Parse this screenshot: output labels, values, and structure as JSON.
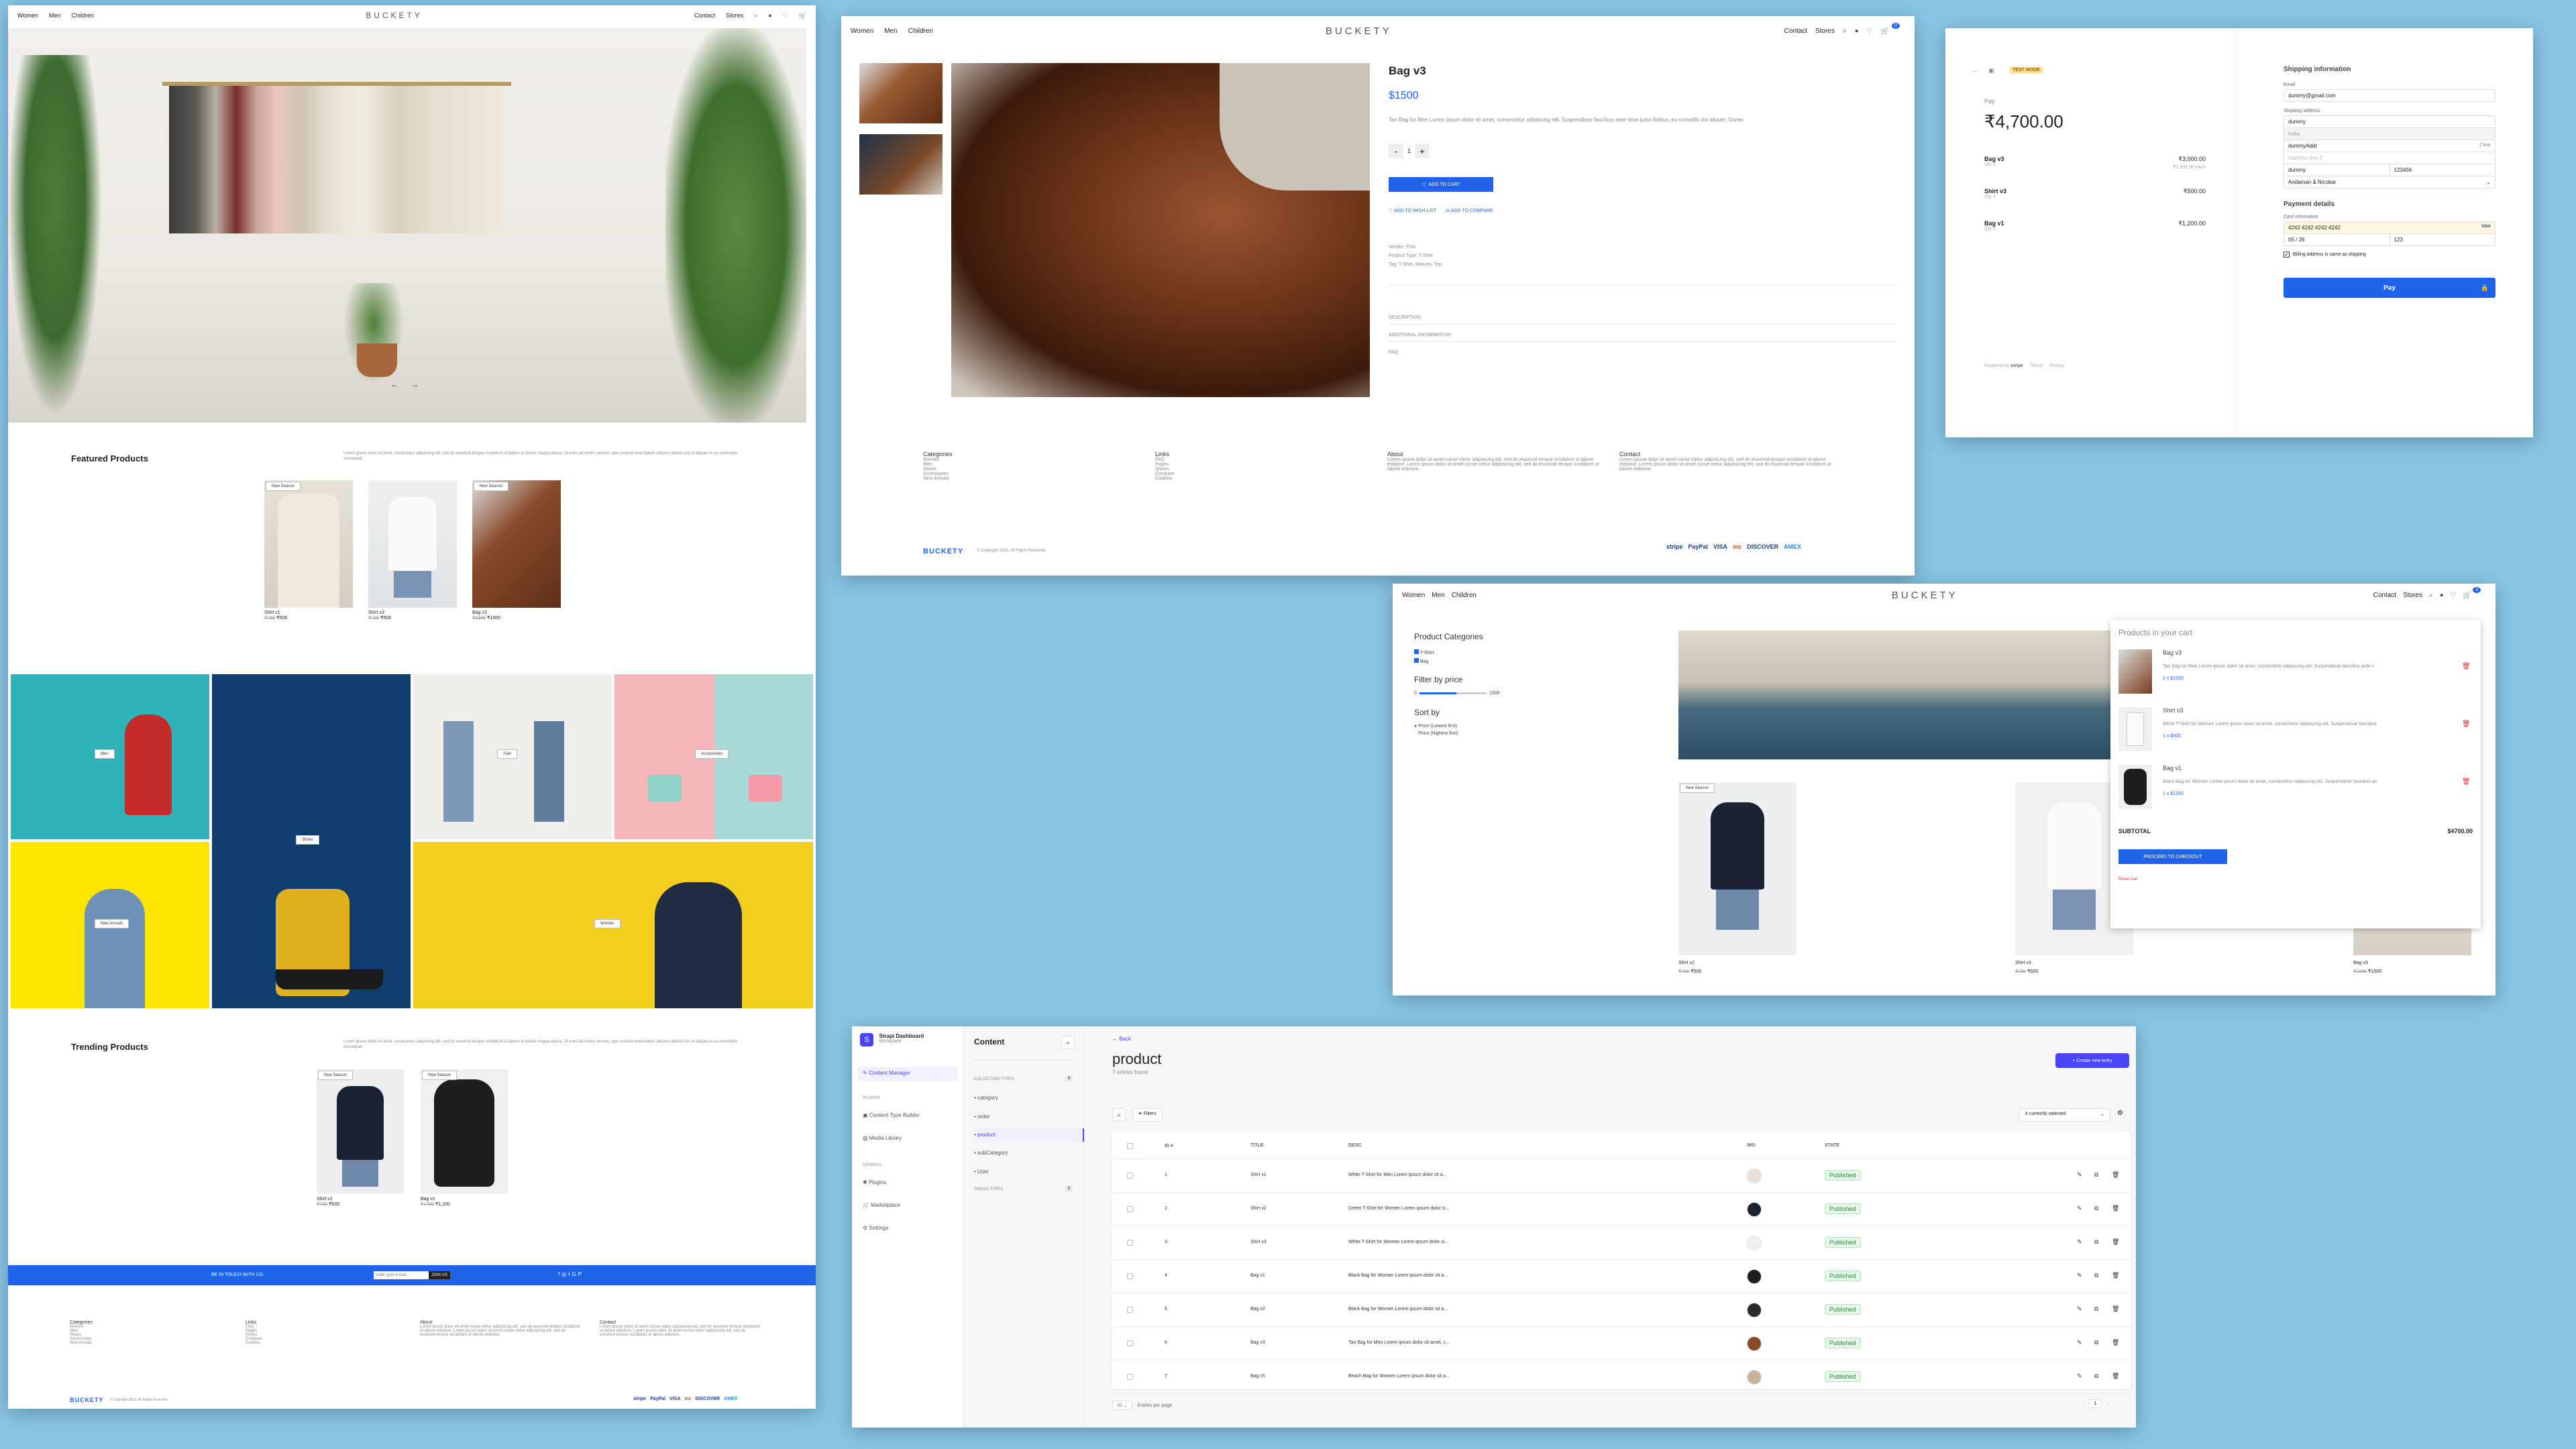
{
  "brand": "BUCKETY",
  "nav": {
    "women": "Women",
    "men": "Men",
    "children": "Children",
    "contact": "Contact",
    "stores": "Stores",
    "cart_count": "0",
    "cart_count_b": "3"
  },
  "home": {
    "featured_title": "Featured Products",
    "featured_desc": "Lorem ipsum dolor sit amet, consectetur adipiscing elit, sed do eiusmod tempor incididunt ut labore et dolore magna aliqua. Ut enim ad minim veniam, quis nostrud exercitation ullamco laboris nisi ut aliquip ex ea commodo consequat.",
    "featured": [
      {
        "badge": "New Season",
        "name": "Shirt v1",
        "old": "₹799",
        "price": "₹500"
      },
      {
        "badge": "",
        "name": "Shirt v3",
        "old": "₹799",
        "price": "₹500"
      },
      {
        "badge": "New Season",
        "name": "Bag v3",
        "old": "₹1999",
        "price": "₹1500"
      }
    ],
    "categories": [
      "Men",
      "Shoes",
      "Sale",
      "Women",
      "Accessories",
      "New Arrivals"
    ],
    "trending_title": "Trending Products",
    "trending_desc": "Lorem ipsum dolor sit amet, consectetur adipiscing elit, sed do eiusmod tempor incididunt ut labore et dolore magna aliqua. Ut enim ad minim veniam, quis nostrud exercitation ullamco laboris nisi ut aliquip ex ea commodo consequat.",
    "trending": [
      {
        "badge": "New Season",
        "name": "Shirt v2",
        "old": "₹799",
        "price": "₹500"
      },
      {
        "badge": "New Season",
        "name": "Bag v1",
        "old": "₹1499",
        "price": "₹1,200"
      }
    ],
    "newsletter_text": "BE IN TOUCH WITH US:",
    "newsletter_placeholder": "Enter your e-mail...",
    "newsletter_button": "JOIN US",
    "copyright": "© Copyright 2023. All Rights Reserved"
  },
  "footer": {
    "categories_title": "Categories",
    "categories": [
      "Women",
      "Men",
      "Shoes",
      "Accessories",
      "New Arrivals"
    ],
    "links_title": "Links",
    "links": [
      "FAQ",
      "Pages",
      "Stores",
      "Compare",
      "Cookies"
    ],
    "about_title": "About",
    "about_text": "Lorem ipsum dolor sit amet conse ctetur adipisicing elit, sed do eiusmod tempor incididunt ut labore etdolore. Lorem ipsum dolor sit amet conse ctetur adipisicing elit, sed do eiusmod tempor incididunt ut labore etdolore.",
    "contact_title": "Contact",
    "contact_text": "Lorem ipsum dolor sit amet conse ctetur adipisicing elit, sed do eiusmod tempor incididunt ut labore etdolore. Lorem ipsum dolor sit amet conse ctetur adipisicing elit, sed do eiusmod tempor incididunt ut labore etdolore.",
    "copyright": "© Copyright 2023. All Rights Reserved",
    "payments": [
      "stripe",
      "PayPal",
      "VISA",
      "mc",
      "DISCOVER",
      "AMEX"
    ]
  },
  "product": {
    "title": "Bag v3",
    "price": "$1500",
    "desc": "Tan Bag for Men Lorem ipsum dolor sit amet, consectetur adipiscing elit. Suspendisse faucibus ante vitae justo finibus, eu convallis dui aliquet. Donec",
    "qty": "1",
    "minus": "-",
    "plus": "+",
    "add_to_cart": "ADD TO CART",
    "wishlist": "ADD TO WISH LIST",
    "compare": "ADD TO COMPARE",
    "meta": [
      "Vendor: Polo",
      "Product Type: T-Shirt",
      "Tag: T-Shirt, Women, Top"
    ],
    "tabs": [
      "DESCRIPTION",
      "ADDITIONAL INFORMATION",
      "FAQ"
    ]
  },
  "checkout": {
    "test_mode": "TEST MODE",
    "pay_label": "Pay",
    "total": "₹4,700.00",
    "items": [
      {
        "name": "Bag v3",
        "qty": "Qty 1",
        "price": "₹3,000.00",
        "each": "₹1,500.00 each"
      },
      {
        "name": "Shirt v3",
        "qty": "Qty 1",
        "price": "₹500.00",
        "each": ""
      },
      {
        "name": "Bag v1",
        "qty": "Qty 1",
        "price": "₹1,200.00",
        "each": ""
      }
    ],
    "powered": "Powered by",
    "stripe": "stripe",
    "terms": "Terms",
    "privacy": "Privacy",
    "shipping_title": "Shipping information",
    "email_label": "Email",
    "email": "dummy@gmail.com",
    "address_label": "Shipping address",
    "name": "dummy",
    "country": "India",
    "address1": "dummyAddr",
    "clear": "Clear",
    "address2_placeholder": "Address line 2",
    "city": "dummy",
    "pin": "123456",
    "state": "Andaman & Nicobar",
    "payment_title": "Payment details",
    "card_label": "Card information",
    "card": "4242 4242 4242 4242",
    "card_brand": "VISA",
    "expiry": "05 / 26",
    "cvc": "123",
    "billing_same": "Billing address is same as shipping",
    "pay_button": "Pay"
  },
  "shop": {
    "categories_title": "Product Categories",
    "cats": [
      "T-Shirt",
      "Bag"
    ],
    "price_title": "Filter by price",
    "price_min": "0",
    "price_max": "1000",
    "price_level": 0.55,
    "sort_title": "Sort by",
    "sort": [
      "Price (Lowest first)",
      "Price (Highest first)"
    ],
    "products": [
      {
        "badge": "New Season",
        "name": "Shirt v2",
        "old": "₹799",
        "price": "₹500"
      },
      {
        "badge": "",
        "name": "Shirt v3",
        "old": "₹799",
        "price": "₹500"
      },
      {
        "badge": "",
        "name": "Bag v3",
        "old": "₹1999",
        "price": "₹1500"
      }
    ],
    "cart_title": "Products in your cart",
    "cart": [
      {
        "name": "Bag v3",
        "desc": "Tan Bag for Men Lorem ipsum dolor sit amet, consectetur adipiscing elit. Suspendisse faucibus ante v",
        "qty": "2 x $1500"
      },
      {
        "name": "Shirt v3",
        "desc": "White T-Shirt for Women Lorem ipsum dolor sit amet, consectetur adipiscing elit. Suspendisse faucibus",
        "qty": "1 x $500"
      },
      {
        "name": "Bag v1",
        "desc": "Black Bag for Women Lorem ipsum dolor sit amet, consectetur adipiscing elit. Suspendisse faucibus an",
        "qty": "1 x $1200"
      }
    ],
    "subtotal_label": "SUBTOTAL",
    "subtotal": "$4700.00",
    "checkout_btn": "PROCEED TO CHECKOUT",
    "reset": "Reset Cart"
  },
  "strapi": {
    "app": "Strapi Dashboard",
    "workspace": "Workplace",
    "content_manager": "Content Manager",
    "plugins_h": "PLUGINS",
    "ctb": "Content-Type Builder",
    "media": "Media Library",
    "general_h": "GENERAL",
    "plugins": "Plugins",
    "marketplace": "Marketplace",
    "settings": "Settings",
    "content": "Content",
    "collection_h": "COLLECTION TYPES",
    "collection_count": "5",
    "collections": [
      "category",
      "order",
      "product",
      "subCategory",
      "User"
    ],
    "single_h": "SINGLE TYPES",
    "single_count": "0",
    "back": "Back",
    "title": "product",
    "entries": "7 entries found",
    "create": "Create new entry",
    "filters": "Filters",
    "columns_selected": "4 currently selected",
    "headers": [
      "ID",
      "TITLE",
      "DESC",
      "IMG",
      "STATE"
    ],
    "rows": [
      {
        "id": "1",
        "title": "Shirt v1",
        "desc": "White T-Shirt for Men Lorem ipsum dolor sit a...",
        "state": "Published"
      },
      {
        "id": "2",
        "title": "Shirt v2",
        "desc": "Green T-Shirt for Women Lorem ipsum dolor si...",
        "state": "Published"
      },
      {
        "id": "3",
        "title": "Shirt v3",
        "desc": "White T-Shirt for Women Lorem ipsum dolor si...",
        "state": "Published"
      },
      {
        "id": "4",
        "title": "Bag v1",
        "desc": "Black Bag for Women Lorem ipsum dolor sit a...",
        "state": "Published"
      },
      {
        "id": "5",
        "title": "Bag v2",
        "desc": "Black Bag for Women Lorem ipsum dolor sit a...",
        "state": "Published"
      },
      {
        "id": "6",
        "title": "Bag v3",
        "desc": "Tan Bag for Men Lorem ipsum dolor sit amet, c...",
        "state": "Published"
      },
      {
        "id": "7",
        "title": "Bag v5",
        "desc": "Beach Bag for Women Lorem ipsum dolor sit a...",
        "state": "Published"
      }
    ],
    "per_page": "10",
    "per_page_label": "Entries per page",
    "page": "1"
  }
}
